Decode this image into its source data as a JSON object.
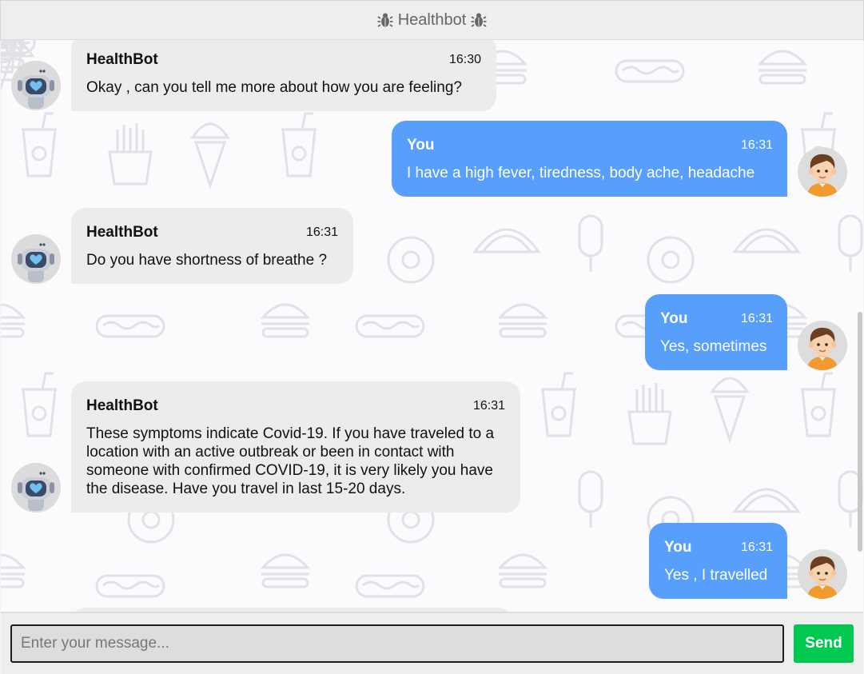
{
  "header": {
    "title": "Healthbot",
    "left_icon": "bug-icon",
    "right_icon": "bug-icon"
  },
  "messages": [
    {
      "sender": "HealthBot",
      "time": "16:30",
      "text": "Okay , can you tell me more about how you are feeling?"
    },
    {
      "sender": "You",
      "time": "16:31",
      "text": "I have a high fever, tiredness, body ache, headache"
    },
    {
      "sender": "HealthBot",
      "time": "16:31",
      "text": "Do you have shortness of breathe ?"
    },
    {
      "sender": "You",
      "time": "16:31",
      "text": "Yes, sometimes"
    },
    {
      "sender": "HealthBot",
      "time": "16:31",
      "text": "These symptoms indicate Covid-19. If you have traveled to a location with an active outbreak or been in contact with someone with confirmed COVID-19, it is very likely you have the disease. Have you travel in last 15-20 days."
    },
    {
      "sender": "You",
      "time": "16:31",
      "text": "Yes , I travelled"
    }
  ],
  "input": {
    "placeholder": "Enter your message...",
    "value": ""
  },
  "send_label": "Send",
  "colors": {
    "user_bubble": "#579ffb",
    "bot_bubble": "#ececec",
    "send_button": "#00c851",
    "header_bg": "#eeeeee"
  }
}
